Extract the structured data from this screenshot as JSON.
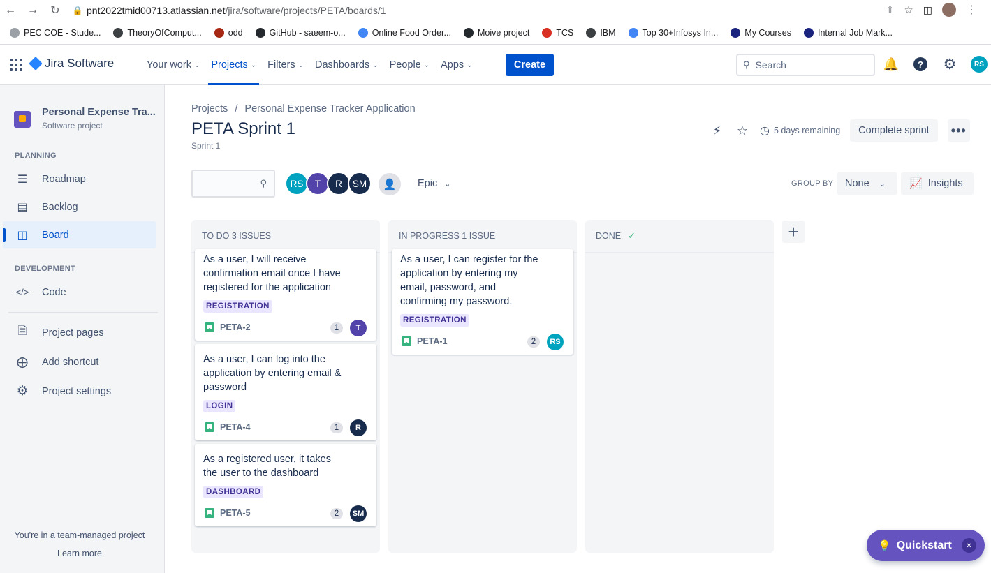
{
  "browser": {
    "url_host": "pnt2022tmid00713.atlassian.net",
    "url_path": "/jira/software/projects/PETA/boards/1",
    "bookmarks": [
      {
        "label": "PEC COE - Stude...",
        "color": "#9aa0a6"
      },
      {
        "label": "TheoryOfComput...",
        "color": "#3c4043"
      },
      {
        "label": "odd",
        "color": "#a52714"
      },
      {
        "label": "GitHub - saeem-o...",
        "color": "#24292e"
      },
      {
        "label": "Online Food Order...",
        "color": "#4285f4"
      },
      {
        "label": "Moive project",
        "color": "#24292e"
      },
      {
        "label": "TCS",
        "color": "#d93025"
      },
      {
        "label": "IBM",
        "color": "#3c4043"
      },
      {
        "label": "Top 30+Infosys In...",
        "color": "#4285f4"
      },
      {
        "label": "My Courses",
        "color": "#1a237e"
      },
      {
        "label": "Internal Job Mark...",
        "color": "#1a237e"
      }
    ]
  },
  "topnav": {
    "logo": "Jira Software",
    "menu": [
      {
        "label": "Your work",
        "active": false
      },
      {
        "label": "Projects",
        "active": true
      },
      {
        "label": "Filters",
        "active": false
      },
      {
        "label": "Dashboards",
        "active": false
      },
      {
        "label": "People",
        "active": false
      },
      {
        "label": "Apps",
        "active": false
      }
    ],
    "create_label": "Create",
    "search_placeholder": "Search",
    "user_initials": "RS"
  },
  "sidebar": {
    "project_name": "Personal Expense Tra...",
    "project_type": "Software project",
    "planning_label": "PLANNING",
    "development_label": "DEVELOPMENT",
    "items": [
      {
        "label": "Roadmap",
        "icon": "roadmap-icon"
      },
      {
        "label": "Backlog",
        "icon": "backlog-icon"
      },
      {
        "label": "Board",
        "icon": "board-icon",
        "active": true
      },
      {
        "label": "Code",
        "icon": "code-icon"
      },
      {
        "label": "Project pages",
        "icon": "page-icon"
      },
      {
        "label": "Add shortcut",
        "icon": "add-shortcut-icon"
      },
      {
        "label": "Project settings",
        "icon": "gear-icon"
      }
    ],
    "footer_note": "You're in a team-managed project",
    "learn_more": "Learn more"
  },
  "header": {
    "breadcrumb": [
      "Projects",
      "/",
      "Personal Expense Tracker Application"
    ],
    "title": "PETA Sprint 1",
    "subtitle": "Sprint 1",
    "remaining": "5 days remaining",
    "complete_label": "Complete sprint",
    "more_label": "•••"
  },
  "filters": {
    "avatars": [
      {
        "initials": "RS",
        "color": "#00a3bf"
      },
      {
        "initials": "T",
        "color": "#5243aa"
      },
      {
        "initials": "R",
        "color": "#172b4d"
      },
      {
        "initials": "SM",
        "color": "#172b4d"
      }
    ],
    "epic_label": "Epic",
    "groupby_label": "GROUP BY",
    "groupby_value": "None",
    "insights_label": "Insights"
  },
  "columns": [
    {
      "title": "TO DO 3 ISSUES",
      "cards": [
        {
          "lines": [
            "As a user, I will receive",
            "confirmation email once I have",
            "registered for the application"
          ],
          "epic": "REGISTRATION",
          "key": "PETA-2",
          "points": "1",
          "assignee": "T",
          "assignee_color": "#5243aa"
        },
        {
          "lines": [
            "As a user, I can log into the",
            "application by entering email &",
            "password"
          ],
          "epic": "LOGIN",
          "key": "PETA-4",
          "points": "1",
          "assignee": "R",
          "assignee_color": "#172b4d"
        },
        {
          "lines": [
            "As a registered user, it takes",
            "the user to the dashboard"
          ],
          "epic": "DASHBOARD",
          "key": "PETA-5",
          "points": "2",
          "assignee": "SM",
          "assignee_color": "#172b4d"
        }
      ]
    },
    {
      "title": "IN PROGRESS 1 ISSUE",
      "cards": [
        {
          "lines": [
            "As a user, I can register for the",
            "application by entering my",
            "email, password, and",
            "confirming my password."
          ],
          "epic": "REGISTRATION",
          "key": "PETA-1",
          "points": "2",
          "assignee": "RS",
          "assignee_color": "#00a3bf"
        }
      ]
    },
    {
      "title": "DONE",
      "cards": []
    }
  ],
  "quickstart": {
    "label": "Quickstart",
    "close": "×"
  }
}
